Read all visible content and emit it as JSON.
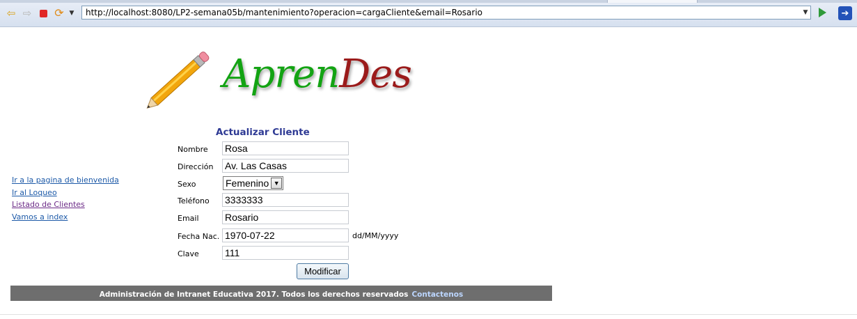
{
  "browser": {
    "url": "http://localhost:8080/LP2-semana05b/mantenimiento?operacion=cargaCliente&email=Rosario",
    "icons": [
      "back-icon",
      "forward-icon",
      "stop-icon",
      "reload-icon",
      "history-dropdown-icon",
      "go-icon",
      "exit-icon"
    ]
  },
  "logo": {
    "part1": "Apren",
    "part2": "Des",
    "colors": {
      "part1": "#13a313",
      "part2": "#9b1b1b"
    }
  },
  "sidebar": {
    "links": [
      {
        "label": "Ir a la pagina de bienvenida"
      },
      {
        "label": "Ir al Loqueo"
      },
      {
        "label": "Listado de Clientes"
      },
      {
        "label": "Vamos a index"
      }
    ]
  },
  "form": {
    "title": "Actualizar Cliente",
    "fields": {
      "nombre": {
        "label": "Nombre",
        "value": "Rosa"
      },
      "direccion": {
        "label": "Dirección",
        "value": "Av. Las Casas"
      },
      "sexo": {
        "label": "Sexo",
        "value": "Femenino"
      },
      "telefono": {
        "label": "Teléfono",
        "value": "3333333"
      },
      "email": {
        "label": "Email",
        "value": "Rosario"
      },
      "fecha": {
        "label": "Fecha Nac.",
        "value": "1970-07-22",
        "hint": "dd/MM/yyyy"
      },
      "clave": {
        "label": "Clave",
        "value": "111"
      }
    },
    "submit_label": "Modificar"
  },
  "footer": {
    "text": "Administración de Intranet Educativa 2017. Todos los derechos reservados",
    "link": "Contactenos"
  },
  "colors": {
    "footer_bg": "#6e6e6e",
    "title": "#2e3a94",
    "link": "#1d5aa8"
  }
}
